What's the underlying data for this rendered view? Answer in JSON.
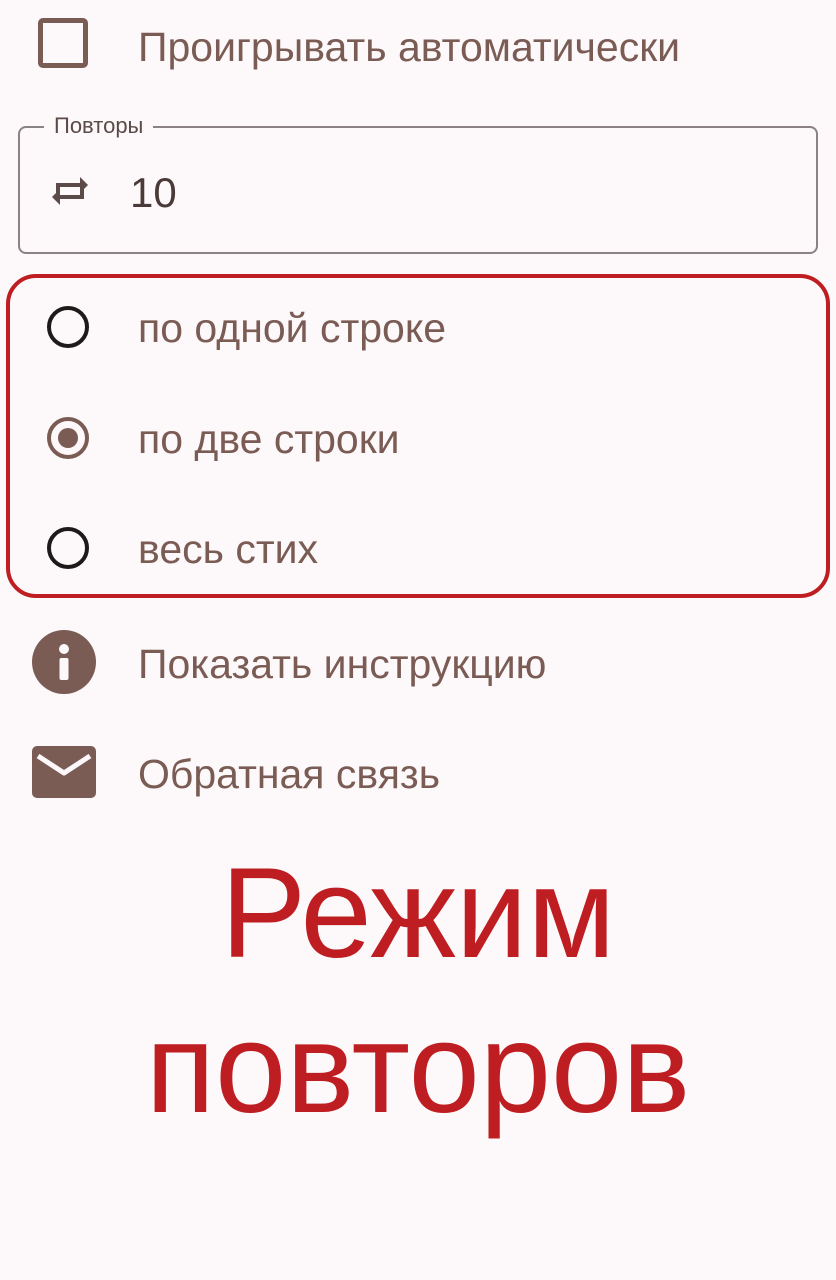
{
  "autoplay": {
    "label": "Проигрывать автоматически",
    "checked": false
  },
  "repeats_field": {
    "label": "Повторы",
    "value": "10",
    "icon": "repeat-icon"
  },
  "repeat_mode": {
    "options": [
      {
        "label": "по одной строке",
        "selected": false
      },
      {
        "label": "по две строки",
        "selected": true
      },
      {
        "label": "весь стих",
        "selected": false
      }
    ],
    "highlight_color": "#be1e22"
  },
  "menu": {
    "instructions": {
      "label": "Показать инструкцию",
      "icon": "info-icon"
    },
    "feedback": {
      "label": "Обратная связь",
      "icon": "mail-icon"
    }
  },
  "caption": {
    "line1": "Режим",
    "line2": "повторов",
    "color": "#be1e22"
  },
  "colors": {
    "accent": "#7a5c55",
    "background": "#fdf8fa"
  }
}
